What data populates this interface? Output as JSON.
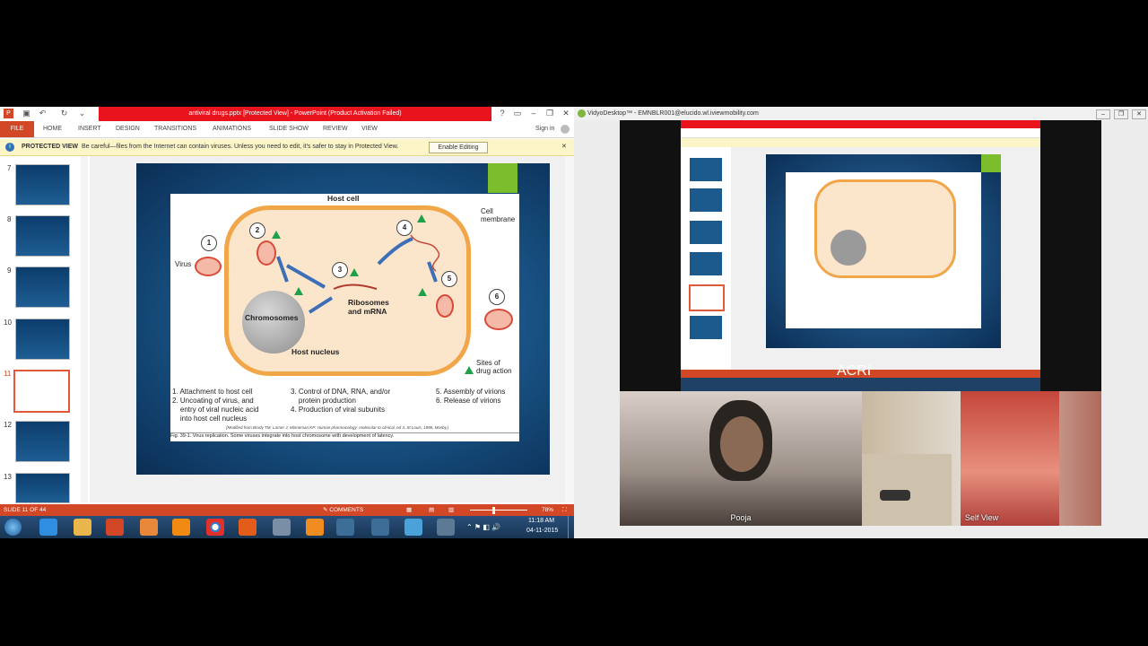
{
  "ppt": {
    "window_title": "antiviral drugs.pptx [Protected View] - PowerPoint (Product Activation Failed)",
    "signin": "Sign in",
    "tabs": [
      "FILE",
      "HOME",
      "INSERT",
      "DESIGN",
      "TRANSITIONS",
      "ANIMATIONS",
      "SLIDE SHOW",
      "REVIEW",
      "VIEW"
    ],
    "protected_label": "PROTECTED VIEW",
    "protected_msg": "Be careful—files from the Internet can contain viruses. Unless you need to edit, it's safer to stay in Protected View.",
    "enable_editing": "Enable Editing",
    "thumbnails": [
      "7",
      "8",
      "9",
      "10",
      "11",
      "12",
      "13"
    ],
    "selected_slide": "11",
    "status_slide": "SLIDE 11 OF 44",
    "status_comments": "COMMENTS",
    "zoom": "78%"
  },
  "slide": {
    "host_cell": "Host cell",
    "cell_membrane": "Cell\nmembrane",
    "virus": "Virus",
    "chromosomes": "Chromosomes",
    "ribosomes": "Ribosomes\nand mRNA",
    "host_nucleus": "Host nucleus",
    "sites": "Sites of\ndrug action",
    "steps": [
      "1",
      "2",
      "3",
      "4",
      "5",
      "6"
    ],
    "legend_col1": "1. Attachment to host cell\n2. Uncoating of virus, and\n    entry of viral nucleic acid\n    into host cell nucleus",
    "legend_col2": "3. Control of DNA, RNA, and/or\n    protein production\n4. Production of viral subunits",
    "legend_col3": "5. Assembly of virions\n6. Release of virions",
    "citation": "(Modified from Brody TM, Larner J, Minneman KP: Human pharmacology: molecular to clinical, ed 3, St Louis, 1998, Mosby.)",
    "caption": "Fig. 39-1. Virus replication. Some viruses integrate into host chromosome with development of latency."
  },
  "taskbar": {
    "time": "11:18 AM",
    "date": "04-11-2015"
  },
  "vidyo": {
    "window_title": "VidyoDesktop™ - EMNBLR001@elucido.wl.iviewmobility.com",
    "overlay_text": "ACRI",
    "participant_1": "Pooja",
    "participant_2": "Self View"
  }
}
